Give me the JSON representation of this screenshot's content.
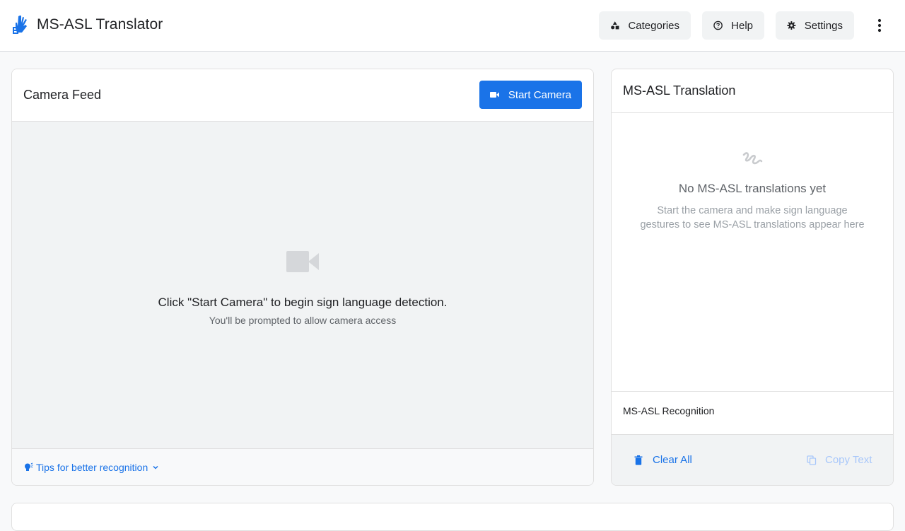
{
  "app": {
    "title": "MS-ASL Translator",
    "logo_icon": "sign-language-hands-icon",
    "accent_color": "#1a73e8"
  },
  "toolbar": {
    "categories_label": "Categories",
    "help_label": "Help",
    "settings_label": "Settings",
    "more_icon": "more-vert-icon"
  },
  "camera": {
    "title": "Camera Feed",
    "start_label": "Start Camera",
    "placeholder_main": "Click \"Start Camera\" to begin sign language detection.",
    "placeholder_sub": "You'll be prompted to allow camera access",
    "tips_label": "Tips for better recognition"
  },
  "translation": {
    "title": "MS-ASL Translation",
    "empty_title": "No MS-ASL translations yet",
    "empty_desc": "Start the camera and make sign language gestures to see MS-ASL translations appear here",
    "recognition_label": "MS-ASL Recognition",
    "clear_label": "Clear All",
    "copy_label": "Copy Text"
  }
}
